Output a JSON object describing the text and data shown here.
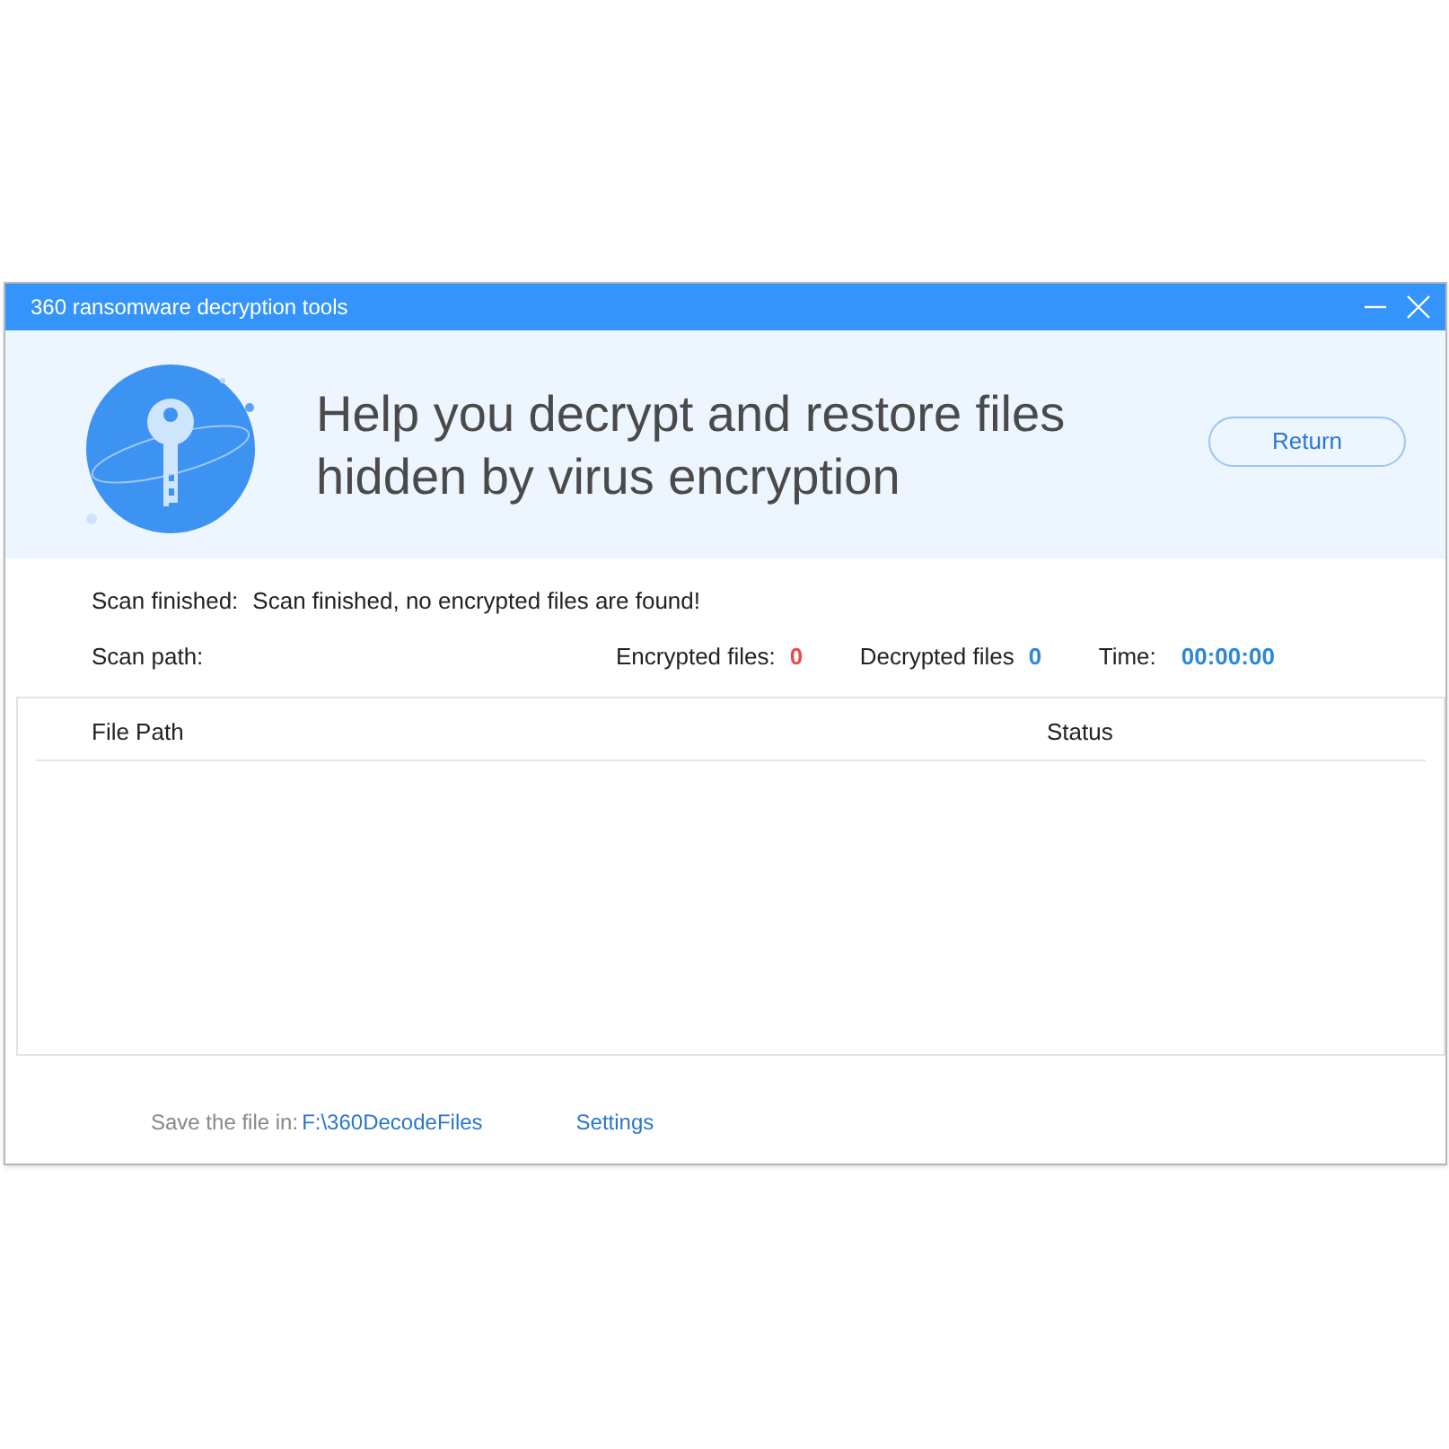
{
  "window": {
    "title": "360 ransomware decryption tools"
  },
  "header": {
    "headline_line1": "Help you decrypt and restore files",
    "headline_line2": "hidden by virus encryption",
    "return_button": "Return"
  },
  "scan": {
    "finished_label": "Scan finished:",
    "finished_message": "Scan finished, no encrypted files are found!",
    "path_label": "Scan path:",
    "encrypted_label": "Encrypted files:",
    "encrypted_count": "0",
    "decrypted_label": "Decrypted files",
    "decrypted_count": "0",
    "time_label": "Time:",
    "time_value": "00:00:00"
  },
  "table": {
    "columns": [
      "File Path",
      "Status"
    ]
  },
  "footer": {
    "save_label": "Save the file in:",
    "save_path": "F:\\360DecodeFiles",
    "settings_link": "Settings"
  }
}
